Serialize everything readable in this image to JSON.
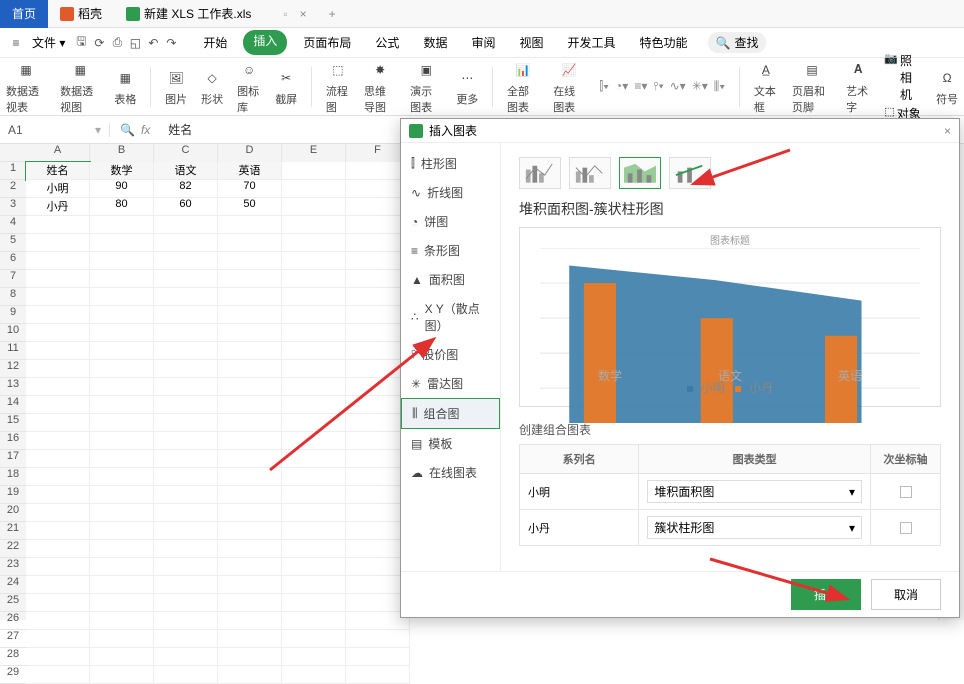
{
  "tabs": {
    "home": "首页",
    "daoke": "稻壳",
    "file": "新建 XLS 工作表.xls"
  },
  "menu": {
    "file": "文件",
    "items": [
      "开始",
      "插入",
      "页面布局",
      "公式",
      "数据",
      "审阅",
      "视图",
      "开发工具",
      "特色功能"
    ],
    "active": "插入",
    "search": "查找"
  },
  "ribbon": {
    "pivot1": "数据透视表",
    "pivot2": "数据透视图",
    "table": "表格",
    "pic": "图片",
    "shape": "形状",
    "iconlib": "图标库",
    "screenshot": "截屏",
    "flow": "流程图",
    "mind": "思维导图",
    "pres": "演示图表",
    "more": "更多",
    "allchart": "全部图表",
    "online": "在线图表",
    "textbox": "文本框",
    "header": "页眉和页脚",
    "wordart": "艺术字",
    "camera": "照相机",
    "object": "对象",
    "symbol": "符号"
  },
  "namebox": "A1",
  "fxvalue": "姓名",
  "cols": [
    "A",
    "B",
    "C",
    "D",
    "E",
    "F"
  ],
  "rows": [
    "1",
    "2",
    "3",
    "4",
    "5",
    "6",
    "7",
    "8",
    "9",
    "10",
    "11",
    "12",
    "13",
    "14",
    "15",
    "16",
    "17",
    "18",
    "19",
    "20",
    "21",
    "22",
    "23",
    "24",
    "25",
    "26",
    "27",
    "28",
    "29"
  ],
  "grid": [
    [
      "姓名",
      "数学",
      "语文",
      "英语",
      "",
      ""
    ],
    [
      "小明",
      "90",
      "82",
      "70",
      "",
      ""
    ],
    [
      "小丹",
      "80",
      "60",
      "50",
      "",
      ""
    ]
  ],
  "dialog": {
    "title": "插入图表",
    "types": [
      "柱形图",
      "折线图",
      "饼图",
      "条形图",
      "面积图",
      "X Y（散点图）",
      "股价图",
      "雷达图",
      "组合图",
      "模板",
      "在线图表"
    ],
    "type_icons": [
      "bar",
      "line",
      "pie",
      "hbar",
      "area",
      "scatter",
      "stock",
      "radar",
      "combo",
      "tpl",
      "online"
    ],
    "selected_type": "组合图",
    "main_title": "堆积面积图-簇状柱形图",
    "preview_title": "图表标题",
    "legend": [
      "小明",
      "小丹"
    ],
    "legend_colors": [
      "#3a7ca8",
      "#e07b2f"
    ],
    "x_categories": [
      "数学",
      "语文",
      "英语"
    ],
    "combo_label": "创建组合图表",
    "combo_headers": [
      "系列名",
      "图表类型",
      "次坐标轴"
    ],
    "combo_rows": [
      {
        "name": "小明",
        "type": "堆积面积图"
      },
      {
        "name": "小丹",
        "type": "簇状柱形图"
      }
    ],
    "insert": "插入",
    "cancel": "取消"
  },
  "chart_data": {
    "type": "combo",
    "categories": [
      "数学",
      "语文",
      "英语"
    ],
    "series": [
      {
        "name": "小明",
        "chart": "area",
        "values": [
          90,
          82,
          70
        ]
      },
      {
        "name": "小丹",
        "chart": "bar",
        "values": [
          80,
          60,
          50
        ]
      }
    ],
    "title": "图表标题",
    "ylim": [
      0,
      100
    ]
  }
}
